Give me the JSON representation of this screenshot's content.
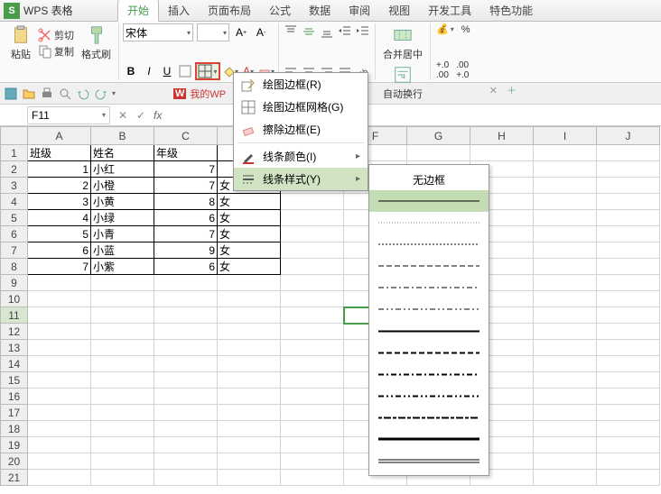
{
  "app": {
    "title": "WPS 表格"
  },
  "tabs": [
    "开始",
    "插入",
    "页面布局",
    "公式",
    "数据",
    "审阅",
    "视图",
    "开发工具",
    "特色功能"
  ],
  "activeTab": 0,
  "ribbon": {
    "paste": "粘贴",
    "cut": "剪切",
    "copy": "复制",
    "fmtPainter": "格式刷",
    "fontName": "宋体",
    "fontSize": "",
    "mergeCenter": "合并居中",
    "autoWrap": "自动换行"
  },
  "wpsDoc": "我的WP",
  "nameBox": "F11",
  "colHeaders": [
    "A",
    "B",
    "C",
    "D",
    "E",
    "F",
    "G",
    "H",
    "I",
    "J"
  ],
  "rowCount": 21,
  "tableData": {
    "headers": [
      "班级",
      "姓名",
      "年级",
      ""
    ],
    "rows": [
      [
        "1",
        "小红",
        "7",
        ""
      ],
      [
        "2",
        "小橙",
        "7",
        "女"
      ],
      [
        "3",
        "小黄",
        "8",
        "女"
      ],
      [
        "4",
        "小绿",
        "6",
        "女"
      ],
      [
        "5",
        "小青",
        "7",
        "女"
      ],
      [
        "6",
        "小蓝",
        "9",
        "女"
      ],
      [
        "7",
        "小紫",
        "6",
        "女"
      ]
    ]
  },
  "borderMenu": {
    "drawBorder": "绘图边框(R)",
    "drawGrid": "绘图边框网格(G)",
    "erase": "擦除边框(E)",
    "lineColor": "线条颜色(I)",
    "lineStyle": "线条样式(Y)"
  },
  "lineStyleMenu": {
    "none": "无边框"
  }
}
